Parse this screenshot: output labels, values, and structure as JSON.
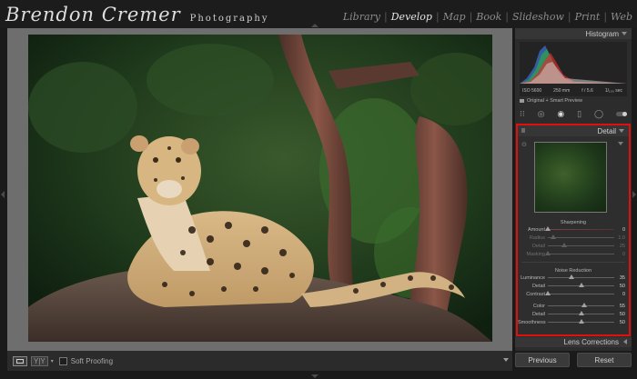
{
  "identity": {
    "name": "Brendon Cremer",
    "subtitle": "Photography"
  },
  "modules": [
    {
      "label": "Library",
      "active": false
    },
    {
      "label": "Develop",
      "active": true
    },
    {
      "label": "Map",
      "active": false
    },
    {
      "label": "Book",
      "active": false
    },
    {
      "label": "Slideshow",
      "active": false
    },
    {
      "label": "Print",
      "active": false
    },
    {
      "label": "Web",
      "active": false
    }
  ],
  "histogram": {
    "title": "Histogram",
    "iso": "ISO 5600",
    "focal": "250 mm",
    "aperture": "f / 5.6",
    "shutter": "1/₁₀₀ sec",
    "preview_label": "Original + Smart Preview"
  },
  "tools": [
    "crop-icon",
    "spot-removal-icon",
    "red-eye-icon",
    "graduated-filter-icon",
    "radial-filter-icon",
    "adjustment-brush-icon"
  ],
  "detail": {
    "title": "Detail",
    "sharpening": {
      "title": "Sharpening",
      "rows": [
        {
          "label": "Amount",
          "value": "0",
          "pos": 0.0,
          "dim": false
        },
        {
          "label": "Radius",
          "value": "1.0",
          "pos": 0.08,
          "dim": true
        },
        {
          "label": "Detail",
          "value": "25",
          "pos": 0.25,
          "dim": true
        },
        {
          "label": "Masking",
          "value": "0",
          "pos": 0.0,
          "dim": true
        }
      ]
    },
    "noise": {
      "title": "Noise Reduction",
      "rows": [
        {
          "label": "Luminance",
          "value": "35",
          "pos": 0.35,
          "dim": false
        },
        {
          "label": "Detail",
          "value": "50",
          "pos": 0.5,
          "dim": false
        },
        {
          "label": "Contrast",
          "value": "0",
          "pos": 0.0,
          "dim": false
        },
        {
          "label": "Color",
          "value": "55",
          "pos": 0.55,
          "dim": false
        },
        {
          "label": "Detail",
          "value": "50",
          "pos": 0.5,
          "dim": false
        },
        {
          "label": "Smoothness",
          "value": "50",
          "pos": 0.5,
          "dim": false
        }
      ]
    }
  },
  "lens": {
    "title": "Lens Corrections"
  },
  "toolbar": {
    "soft_proofing": "Soft Proofing",
    "yy": "Y|Y"
  },
  "buttons": {
    "previous": "Previous",
    "reset": "Reset"
  },
  "colors": {
    "highlight_border": "#e01010"
  }
}
